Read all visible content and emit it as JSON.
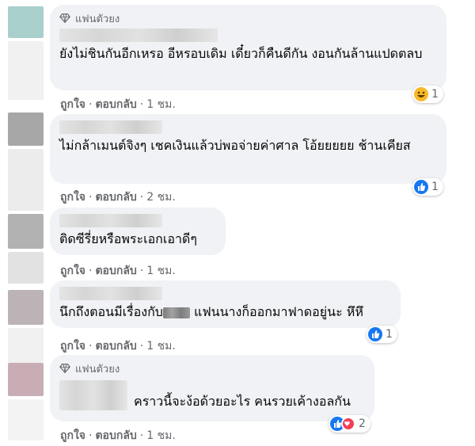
{
  "comments": [
    {
      "badge": "แฟนตัวยง",
      "text": "ยังไม่ชินกันอีกเหรอ อีหรอบเดิม เดี๋ยวก็คืนดีกัน งอนกันล้านแปดตลบ",
      "like": "ถูกใจ",
      "reply": "ตอบกลับ",
      "time": "1 ชม.",
      "reactions": [
        "haha"
      ],
      "count": "1",
      "avatar_color": "#a9cfcd"
    },
    {
      "text": "ไม่กล้าเมนต์จิงๆ เชคเงินแล้วบ่พอจ่ายค่าศาล โอ้ยยยยย ช้านเคียส",
      "like": "ถูกใจ",
      "reply": "ตอบกลับ",
      "time": "2 ชม.",
      "reactions": [
        "like"
      ],
      "count": "1",
      "avatar_color": "#a7a7a7"
    },
    {
      "text": "ติดซีรี่ยหรือพระเอกเอาดีๆ",
      "like": "ถูกใจ",
      "reply": "ตอบกลับ",
      "time": "1 ชม.",
      "reactions": [],
      "count": "",
      "avatar_color": "#b2b2b2"
    },
    {
      "text_before": "นึกถึงตอนมีเรื่องกับ",
      "text_after": " แฟนนางก็ออกมาฟาดอยู่นะ หึหึ",
      "like": "ถูกใจ",
      "reply": "ตอบกลับ",
      "time": "1 ชม.",
      "reactions": [
        "like"
      ],
      "count": "1",
      "avatar_color": "#bcb3b6"
    },
    {
      "badge": "แฟนตัวยง",
      "text": "คราวนี้จะง้อด้วยอะไร คนรวยเค้างอลกัน",
      "like": "ถูกใจ",
      "reply": "ตอบกลับ",
      "time": "1 ชม.",
      "reactions": [
        "like",
        "love"
      ],
      "count": "2",
      "avatar_color": "#c9adb5"
    }
  ],
  "colors": {
    "bubble": "#f0f2f5",
    "meta": "#65676b",
    "like_blue": "#1877f2",
    "love_red": "#f33e58",
    "haha_yellow": "#f7b928"
  }
}
